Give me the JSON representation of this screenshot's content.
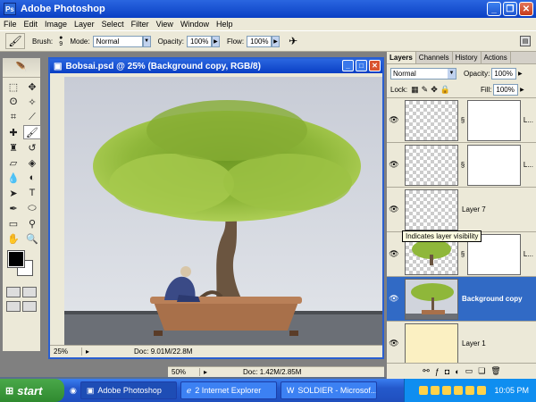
{
  "window": {
    "title": "Adobe Photoshop",
    "app_icon": "Ps"
  },
  "menu": [
    "File",
    "Edit",
    "Image",
    "Layer",
    "Select",
    "Filter",
    "View",
    "Window",
    "Help"
  ],
  "options": {
    "brush_label": "Brush:",
    "brush_size": "9",
    "mode_label": "Mode:",
    "mode_value": "Normal",
    "opacity_label": "Opacity:",
    "opacity_value": "100%",
    "flow_label": "Flow:",
    "flow_value": "100%"
  },
  "document": {
    "title": "Bobsai.psd @ 25% (Background copy, RGB/8)",
    "zoom": "25%",
    "doc_info": "Doc: 9.01M/22.8M"
  },
  "document2": {
    "zoom": "50%",
    "doc_info": "Doc: 1.42M/2.85M"
  },
  "layers_panel": {
    "tabs": [
      "Layers",
      "Channels",
      "History",
      "Actions"
    ],
    "blend_mode": "Normal",
    "opacity_label": "Opacity:",
    "opacity_value": "100%",
    "lock_label": "Lock:",
    "fill_label": "Fill:",
    "fill_value": "100%",
    "tooltip": "Indicates layer visibility",
    "layers": [
      {
        "name": "L...",
        "selected": false
      },
      {
        "name": "L...",
        "selected": false
      },
      {
        "name": "Layer 7",
        "selected": false
      },
      {
        "name": "L...",
        "selected": false
      },
      {
        "name": "Background copy",
        "selected": true
      },
      {
        "name": "Layer 1",
        "selected": false
      }
    ]
  },
  "taskbar": {
    "start_label": "start",
    "buttons": [
      "Adobe Photoshop",
      "2 Internet Explorer",
      "SOLDIER - Microsof..."
    ],
    "clock": "10:05 PM"
  },
  "colors": {
    "titlebar": "#0a3fc4",
    "selection": "#316ac5",
    "taskbar": "#2459cc",
    "start": "#2f8a2f"
  }
}
